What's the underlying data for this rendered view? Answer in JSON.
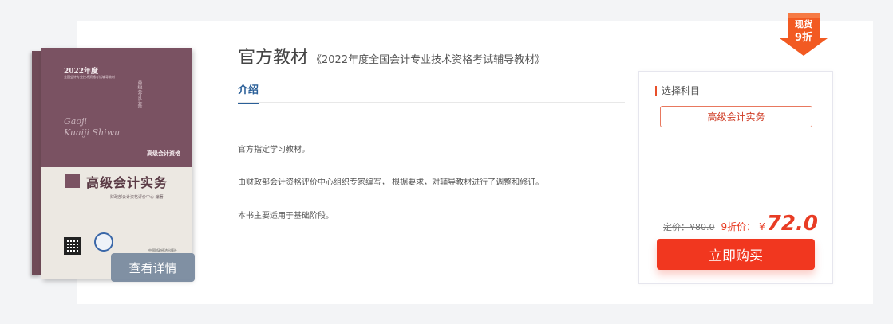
{
  "product": {
    "title": "官方教材",
    "subtitle": "《2022年度全国会计专业技术资格考试辅导教材》",
    "detail_button": "查看详情"
  },
  "book_cover": {
    "year": "2022年度",
    "series": "全国会计专业技术资格考试辅导教材",
    "pinyin_line1": "Gaoji",
    "pinyin_line2": "Kuaiji Shiwu",
    "vertical_title": "高级会计实务",
    "level_tag": "高级会计资格",
    "title": "高级会计实务",
    "author": "财政部会计资格评价中心 编著",
    "publisher": "中国财政经济出版社"
  },
  "tabs": [
    {
      "label": "介绍"
    }
  ],
  "description": [
    "官方指定学习教材。",
    "由财政部会计资格评价中心组织专家编写， 根据要求，对辅导教材进行了调整和修订。",
    "本书主要适用于基础阶段。"
  ],
  "purchase": {
    "select_label": "选择科目",
    "subject_option": "高级会计实务",
    "original_price": "定价：¥80.0",
    "discount_label": "9折价：",
    "currency": "¥",
    "price": "72.0",
    "buy_button": "立即购买"
  },
  "badge": {
    "line1": "现货",
    "line2": "9折"
  },
  "colors": {
    "accent_red": "#f1371f",
    "tab_blue": "#2a5f98",
    "book_maroon": "#7a5262",
    "badge_orange": "#f25a22"
  }
}
